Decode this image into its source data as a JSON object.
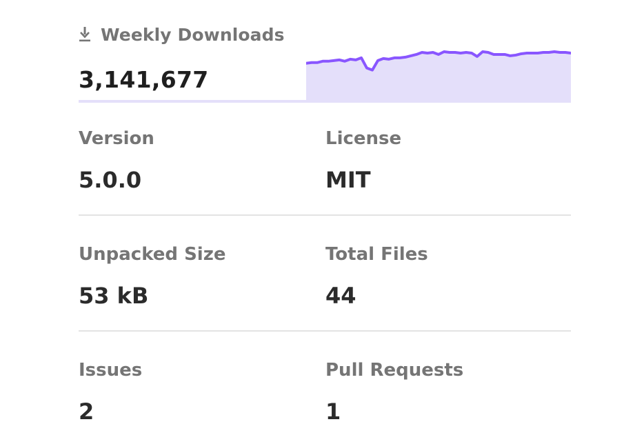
{
  "downloads": {
    "label": "Weekly Downloads",
    "count": "3,141,677",
    "icon": "download-icon",
    "sparkline_color": "#8956ff",
    "sparkline_fill": "#e4dffa",
    "trend": [
      58,
      59,
      59,
      61,
      61,
      62,
      63,
      61,
      64,
      63,
      66,
      51,
      48,
      62,
      65,
      64,
      66,
      66,
      67,
      69,
      71,
      74,
      73,
      74,
      71,
      75,
      74,
      74,
      73,
      74,
      73,
      68,
      75,
      74,
      71,
      71,
      71,
      69,
      70,
      72,
      73,
      73,
      73,
      74,
      74,
      75,
      74,
      74,
      73
    ]
  },
  "stats": {
    "version": {
      "label": "Version",
      "value": "5.0.0"
    },
    "license": {
      "label": "License",
      "value": "MIT"
    },
    "unpacked_size": {
      "label": "Unpacked Size",
      "value": "53 kB"
    },
    "total_files": {
      "label": "Total Files",
      "value": "44"
    },
    "issues": {
      "label": "Issues",
      "value": "2"
    },
    "pull_requests": {
      "label": "Pull Requests",
      "value": "1"
    }
  }
}
